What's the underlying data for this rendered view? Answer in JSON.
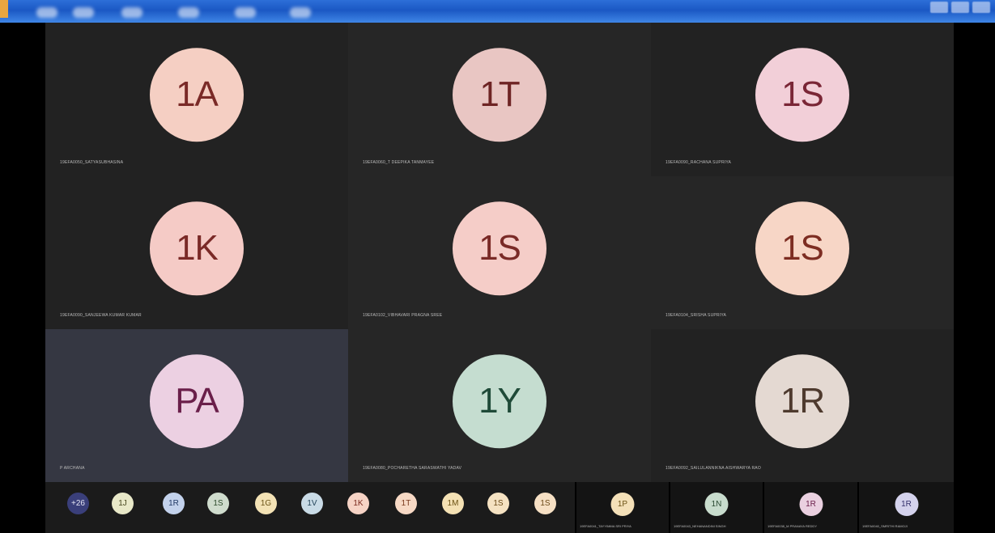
{
  "window": {
    "accent": "#1f5fcc"
  },
  "tiles": [
    {
      "initials": "1A",
      "name": "19EFA0050_SATYASUBHASINA",
      "bg": "#f5cfc3",
      "fg": "#7a2a27"
    },
    {
      "initials": "1T",
      "name": "19EFA0060_T DEEPIKA TANMAYEE",
      "bg": "#e9c6c3",
      "fg": "#6e2424"
    },
    {
      "initials": "1S",
      "name": "19EFA0090_RACHANA SUPRIYA",
      "bg": "#f2cfd8",
      "fg": "#7a2636"
    },
    {
      "initials": "1K",
      "name": "19EFA0090_SANJEEWA KUMAR KUMAR",
      "bg": "#f5cbc6",
      "fg": "#7a2a27"
    },
    {
      "initials": "1S",
      "name": "19EFA0102_VIBHAVARI PRAGNA SREE",
      "bg": "#f5cdc8",
      "fg": "#7a2a27"
    },
    {
      "initials": "1S",
      "name": "19EFA0104_SRISHA SUPRIYA",
      "bg": "#f7d6c6",
      "fg": "#7d2d22"
    },
    {
      "initials": "PA",
      "name": "P ARCHANA",
      "bg": "#ecd0e2",
      "fg": "#6a1f4a"
    },
    {
      "initials": "1Y",
      "name": "19EFA0080_POCHARETHA SARASWATHI YADAV",
      "bg": "#c5ddd0",
      "fg": "#1f4a38"
    },
    {
      "initials": "1R",
      "name": "19EFA0092_SAILULANNIKNA AISHWARYA RAO",
      "bg": "#e4d9d2",
      "fg": "#4e3a2e"
    }
  ],
  "strip": {
    "more": {
      "label": "+26",
      "bg": "#3a3f7a",
      "fg": "#e6e6f5"
    },
    "avatars": [
      {
        "initials": "1J",
        "bg": "#e8e8c8",
        "fg": "#4a4a22"
      },
      {
        "initials": "1R",
        "bg": "#c3d2ec",
        "fg": "#233a66"
      },
      {
        "initials": "1S",
        "bg": "#cfdccd",
        "fg": "#2d4a2b"
      },
      {
        "initials": "1G",
        "bg": "#f3e2b5",
        "fg": "#6b5418"
      },
      {
        "initials": "1V",
        "bg": "#c9dbe6",
        "fg": "#24455a"
      },
      {
        "initials": "1K",
        "bg": "#f6d3c5",
        "fg": "#7a2a1e"
      },
      {
        "initials": "1T",
        "bg": "#f7d9c5",
        "fg": "#7a3a1e"
      },
      {
        "initials": "1M",
        "bg": "#f4e1b4",
        "fg": "#6b5214"
      },
      {
        "initials": "1S",
        "bg": "#f5e2c2",
        "fg": "#6b4a18"
      },
      {
        "initials": "1S",
        "bg": "#f6e0c4",
        "fg": "#6b4a18"
      }
    ],
    "tiles": [
      {
        "initials": "1P",
        "name": "19EFA0041_TAYYIMMA SRI PRIYA",
        "bg": "#f4e0b8",
        "fg": "#6b5214"
      },
      {
        "initials": "1N",
        "name": "19EFA0043_NEHANANDINI SINGH",
        "bg": "#c8dccd",
        "fg": "#2b4a33"
      },
      {
        "initials": "1R",
        "name": "19EFA0038_M PRANAYA REDDY",
        "bg": "#ead0e0",
        "fg": "#6a1f4a"
      },
      {
        "initials": "1R",
        "name": "19EFA0040_SMRITHI RAMOJI",
        "bg": "#d4d2ec",
        "fg": "#34306a"
      }
    ]
  }
}
